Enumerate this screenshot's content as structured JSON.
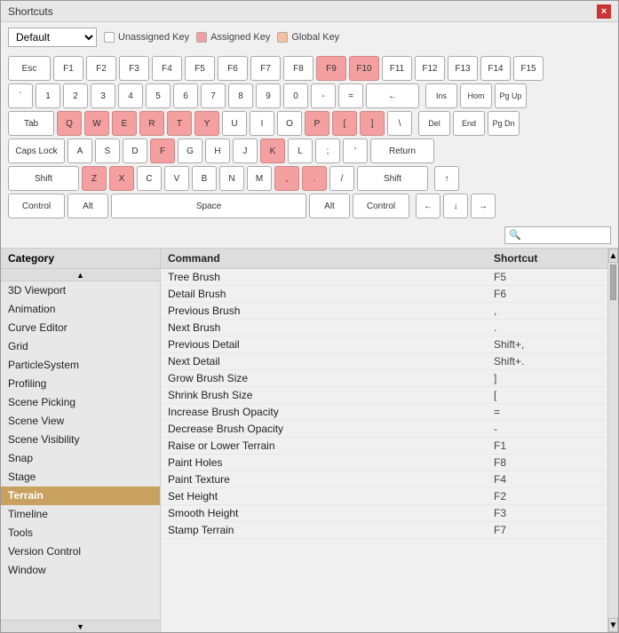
{
  "window": {
    "title": "Shortcuts",
    "close_label": "×"
  },
  "toolbar": {
    "preset_value": "Default",
    "preset_options": [
      "Default"
    ],
    "legend": {
      "unassigned_label": "Unassigned Key",
      "assigned_label": "Assigned Key",
      "global_label": "Global Key"
    }
  },
  "keyboard": {
    "rows": [
      {
        "id": "row-esc-fn",
        "keys": [
          {
            "label": "Esc",
            "class": "key wide-2",
            "state": "normal"
          },
          {
            "label": "F1",
            "class": "key small-f",
            "state": "normal"
          },
          {
            "label": "F2",
            "class": "key small-f",
            "state": "normal"
          },
          {
            "label": "F3",
            "class": "key small-f",
            "state": "normal"
          },
          {
            "label": "F4",
            "class": "key small-f",
            "state": "normal"
          },
          {
            "label": "F5",
            "class": "key small-f",
            "state": "normal"
          },
          {
            "label": "F6",
            "class": "key small-f",
            "state": "normal"
          },
          {
            "label": "F7",
            "class": "key small-f",
            "state": "normal"
          },
          {
            "label": "F8",
            "class": "key small-f",
            "state": "normal"
          },
          {
            "label": "F9",
            "class": "key small-f assigned",
            "state": "assigned"
          },
          {
            "label": "F10",
            "class": "key small-f assigned",
            "state": "assigned"
          },
          {
            "label": "F11",
            "class": "key small-f",
            "state": "normal"
          },
          {
            "label": "F12",
            "class": "key small-f",
            "state": "normal"
          },
          {
            "label": "F13",
            "class": "key small-f",
            "state": "normal"
          },
          {
            "label": "F14",
            "class": "key small-f",
            "state": "normal"
          },
          {
            "label": "F15",
            "class": "key small-f",
            "state": "normal"
          }
        ]
      }
    ]
  },
  "search": {
    "placeholder": "🔍",
    "value": ""
  },
  "categories": {
    "header": "Category",
    "items": [
      {
        "label": "3D Viewport",
        "selected": false
      },
      {
        "label": "Animation",
        "selected": false
      },
      {
        "label": "Curve Editor",
        "selected": false
      },
      {
        "label": "Grid",
        "selected": false
      },
      {
        "label": "ParticleSystem",
        "selected": false
      },
      {
        "label": "Profiling",
        "selected": false
      },
      {
        "label": "Scene Picking",
        "selected": false
      },
      {
        "label": "Scene View",
        "selected": false
      },
      {
        "label": "Scene Visibility",
        "selected": false
      },
      {
        "label": "Snap",
        "selected": false
      },
      {
        "label": "Stage",
        "selected": false
      },
      {
        "label": "Terrain",
        "selected": true
      },
      {
        "label": "Timeline",
        "selected": false
      },
      {
        "label": "Tools",
        "selected": false
      },
      {
        "label": "Version Control",
        "selected": false
      },
      {
        "label": "Window",
        "selected": false
      }
    ]
  },
  "commands": {
    "header_command": "Command",
    "header_shortcut": "Shortcut",
    "items": [
      {
        "name": "Tree Brush",
        "shortcut": "F5"
      },
      {
        "name": "Detail Brush",
        "shortcut": "F6"
      },
      {
        "name": "Previous Brush",
        "shortcut": ","
      },
      {
        "name": "Next Brush",
        "shortcut": "."
      },
      {
        "name": "Previous Detail",
        "shortcut": "Shift+,"
      },
      {
        "name": "Next Detail",
        "shortcut": "Shift+."
      },
      {
        "name": "Grow Brush Size",
        "shortcut": "]"
      },
      {
        "name": "Shrink Brush Size",
        "shortcut": "["
      },
      {
        "name": "Increase Brush Opacity",
        "shortcut": "="
      },
      {
        "name": "Decrease Brush Opacity",
        "shortcut": "-"
      },
      {
        "name": "Raise or Lower Terrain",
        "shortcut": "F1"
      },
      {
        "name": "Paint Holes",
        "shortcut": "F8"
      },
      {
        "name": "Paint Texture",
        "shortcut": "F4"
      },
      {
        "name": "Set Height",
        "shortcut": "F2"
      },
      {
        "name": "Smooth Height",
        "shortcut": "F3"
      },
      {
        "name": "Stamp Terrain",
        "shortcut": "F7"
      }
    ]
  }
}
